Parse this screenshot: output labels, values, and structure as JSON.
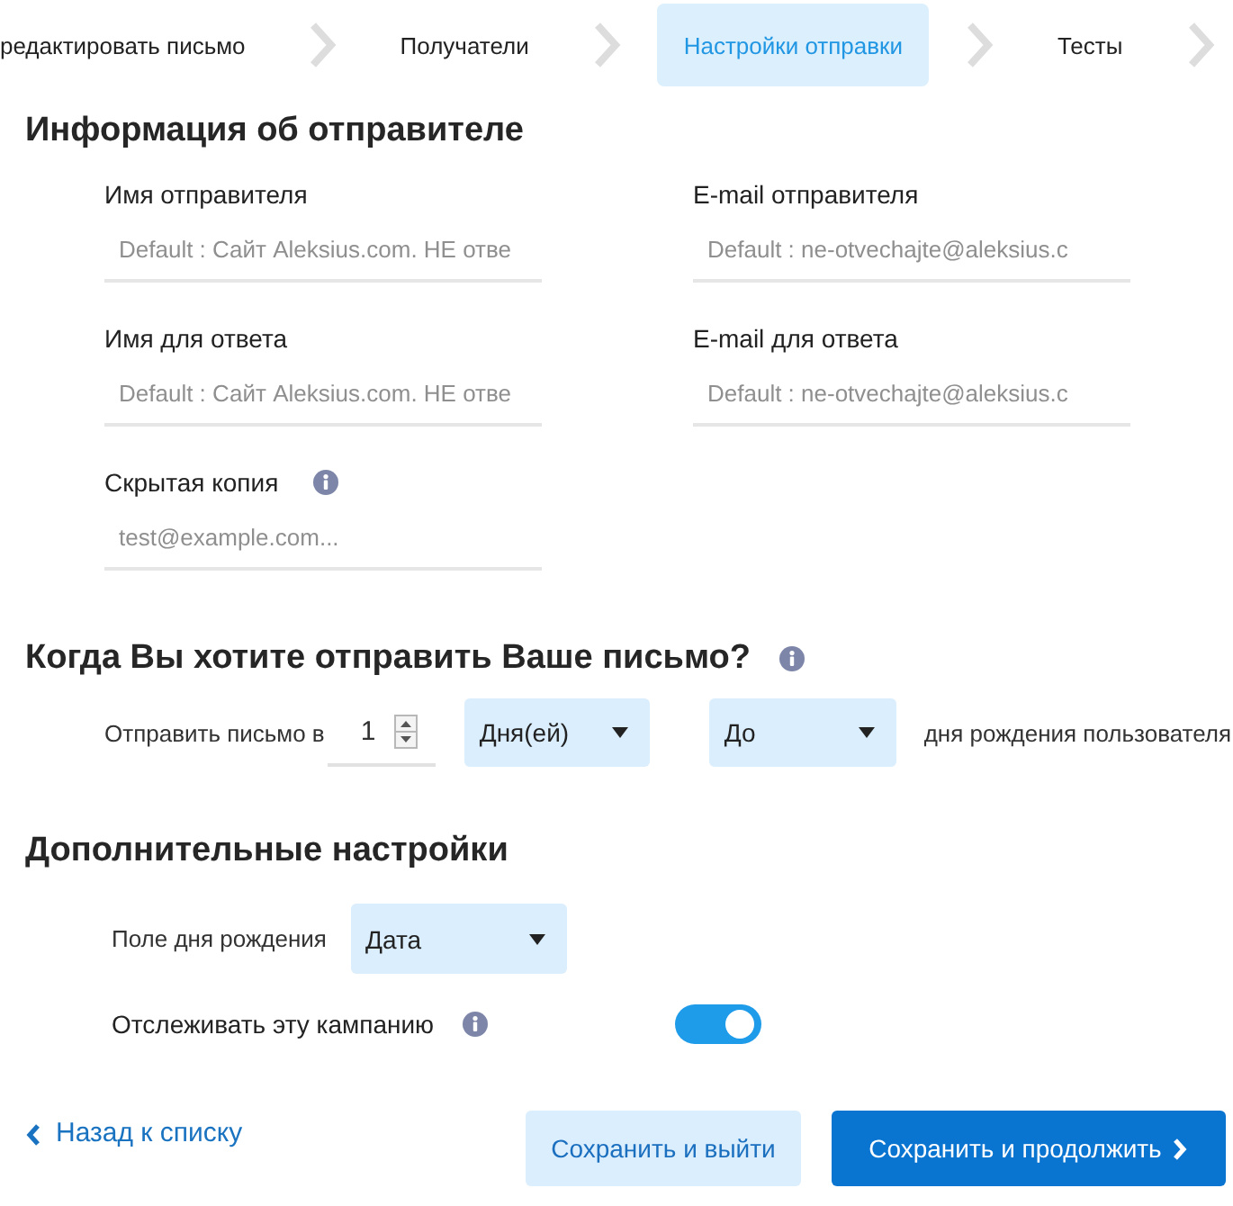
{
  "steps": [
    {
      "label": "редактировать письмо",
      "selected": false
    },
    {
      "label": "Получатели",
      "selected": false
    },
    {
      "label": "Настройки отправки",
      "selected": true
    },
    {
      "label": "Тесты",
      "selected": false
    }
  ],
  "sender_info": {
    "title": "Информация об отправителе",
    "fields": [
      {
        "label": "Имя отправителя",
        "placeholder": "Default : Сайт Aleksius.com. НЕ отве",
        "info": false
      },
      {
        "label": "E-mail отправителя",
        "placeholder": "Default : ne-otvechajte@aleksius.c",
        "info": false
      },
      {
        "label": "Имя для ответа",
        "placeholder": "Default : Сайт Aleksius.com. НЕ отве",
        "info": false
      },
      {
        "label": "E-mail для ответа",
        "placeholder": "Default : ne-otvechajte@aleksius.c",
        "info": false
      },
      {
        "label": "Скрытая копия",
        "placeholder": "test@example.com...",
        "info": true
      }
    ]
  },
  "schedule": {
    "title": "Когда Вы хотите отправить Ваше письмо?",
    "info": true,
    "label": "Отправить письмо в",
    "amount": "1",
    "unit": "Дня(ей)",
    "relation": "До",
    "suffix": "дня рождения пользователя"
  },
  "additional": {
    "title": "Дополнительные настройки",
    "birthday_field": {
      "label": "Поле дня рождения",
      "value": "Дата"
    },
    "tracking": {
      "label": "Отслеживать эту кампанию",
      "info": true,
      "on": true
    }
  },
  "footer": {
    "back": "Назад к списку",
    "buttons": [
      {
        "label": "Сохранить и выйти",
        "kind": "secondary"
      },
      {
        "label": "Сохранить и продолжить",
        "kind": "primary"
      }
    ]
  }
}
